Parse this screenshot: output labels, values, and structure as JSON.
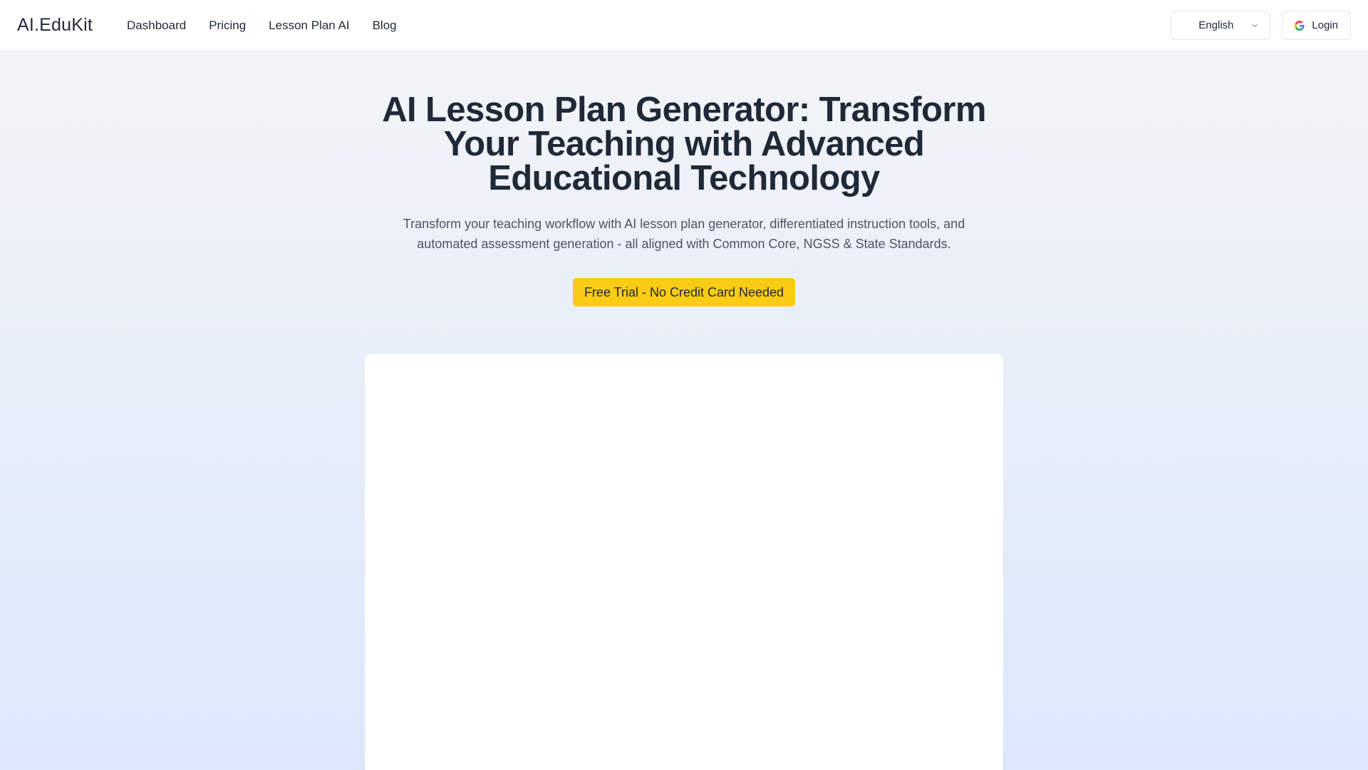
{
  "header": {
    "logo": "AI.EduKit",
    "nav": [
      {
        "label": "Dashboard"
      },
      {
        "label": "Pricing"
      },
      {
        "label": "Lesson Plan AI"
      },
      {
        "label": "Blog"
      }
    ],
    "language": "English",
    "login_label": "Login"
  },
  "hero": {
    "title": "AI Lesson Plan Generator: Transform Your Teaching with Advanced Educational Technology",
    "subtitle": "Transform your teaching workflow with AI lesson plan generator, differentiated instruction tools, and automated assessment generation - all aligned with Common Core, NGSS & State Standards.",
    "cta_label": "Free Trial - No Credit Card Needed"
  },
  "colors": {
    "accent": "#facc15",
    "text": "#1f2937",
    "muted": "#4b5563"
  },
  "icons": {
    "language": "chevron-down-icon",
    "login": "google-icon"
  }
}
